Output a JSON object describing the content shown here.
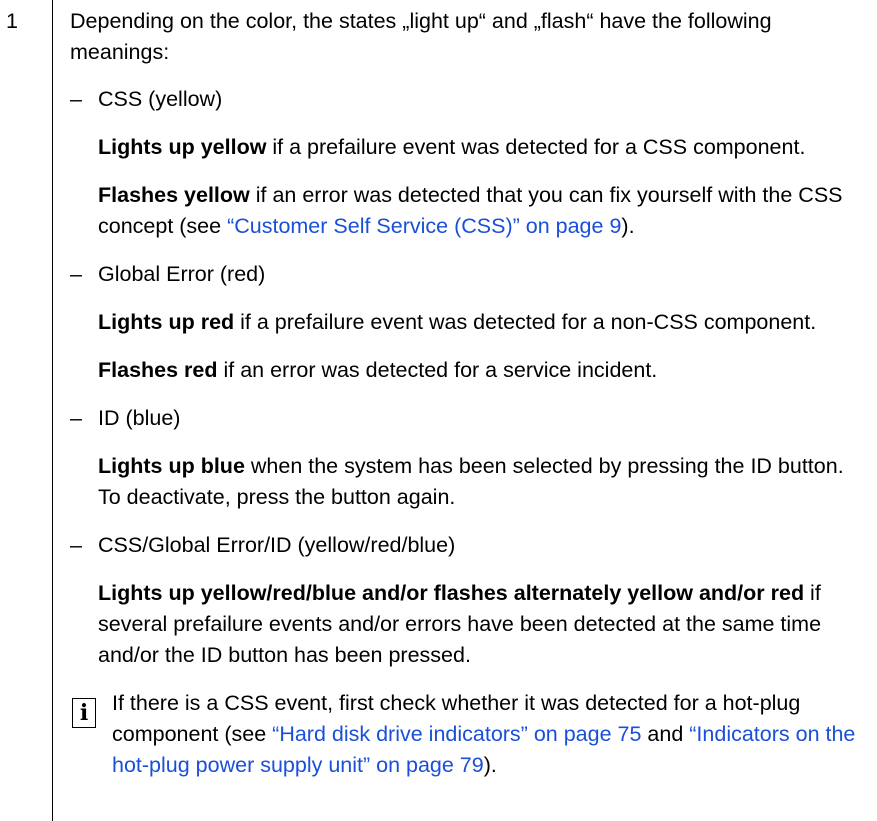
{
  "step_number": "1",
  "intro": "Depending on the color, the states „light up“ and „flash“ have the following meanings:",
  "dash": "–",
  "css": {
    "heading": "CSS (yellow)",
    "p1_bold": "Lights up yellow",
    "p1_text": " if a prefailure event was detected for a CSS component.",
    "p2_bold": "Flashes yellow",
    "p2_text": " if an error was detected that you can fix yourself with the CSS concept (see ",
    "p2_link": "“Customer Self Service (CSS)” on page 9",
    "p2_tail": ")."
  },
  "global": {
    "heading": "Global Error (red)",
    "p1_bold": "Lights up red",
    "p1_text": " if a prefailure event was detected for a non-CSS component.",
    "p2_bold": "Flashes red",
    "p2_text": " if an error was detected for a service incident."
  },
  "id": {
    "heading": "ID (blue)",
    "p1_bold": "Lights up blue",
    "p1_text": " when the system has been selected by pressing the ID button. To deactivate, press the button again."
  },
  "combo": {
    "heading": "CSS/Global Error/ID (yellow/red/blue)",
    "p1_bold": "Lights up yellow/red/blue and/or flashes alternately yellow and/or red",
    "p1_text": " if several prefailure events and/or errors have been detected at the same time and/or the ID button has been pressed."
  },
  "hint": {
    "icon_glyph": "i",
    "text1": "If there is a CSS event, first check whether it was detected for a hot-plug component (see ",
    "link1": "“Hard disk drive indicators” on page 75",
    "text2": " and ",
    "link2": "“Indicators on the hot-plug power supply unit” on page 79",
    "text3": ")."
  },
  "colors": {
    "link": "#1a4fd8",
    "text": "#000000"
  }
}
